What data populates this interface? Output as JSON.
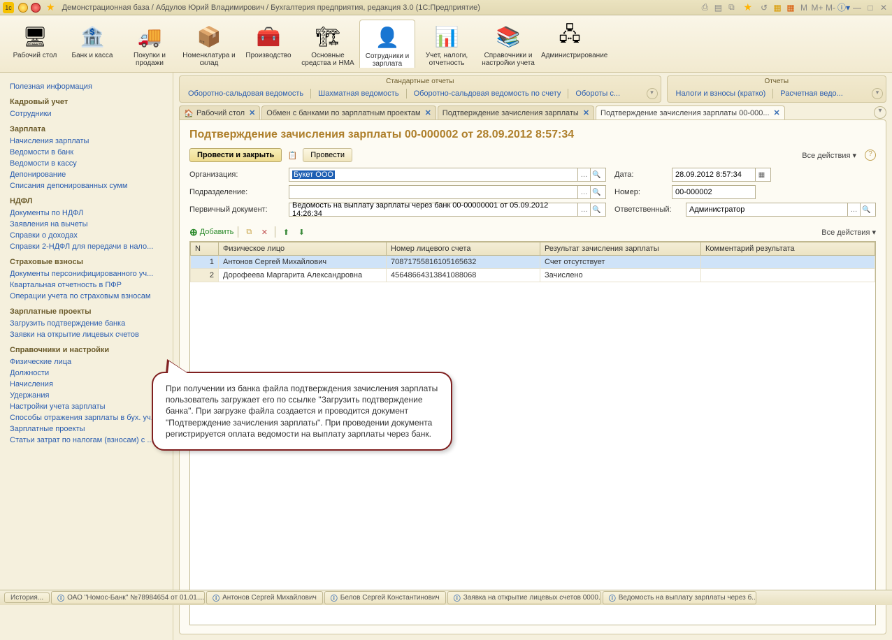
{
  "titlebar": {
    "title": "Демонстрационная база / Абдулов Юрий Владимирович / Бухгалтерия предприятия, редакция 3.0  (1С:Предприятие)",
    "m_labels": [
      "M",
      "M+",
      "M-"
    ]
  },
  "toolbar": [
    {
      "label": "Рабочий стол"
    },
    {
      "label": "Банк и касса"
    },
    {
      "label": "Покупки и продажи"
    },
    {
      "label": "Номенклатура и склад"
    },
    {
      "label": "Производство"
    },
    {
      "label": "Основные средства и НМА"
    },
    {
      "label": "Сотрудники и зарплата"
    },
    {
      "label": "Учет, налоги, отчетность"
    },
    {
      "label": "Справочники и настройки учета"
    },
    {
      "label": "Администрирование"
    }
  ],
  "sidebar": {
    "top_link": "Полезная информация",
    "groups": [
      {
        "title": "Кадровый учет",
        "items": [
          "Сотрудники"
        ]
      },
      {
        "title": "Зарплата",
        "items": [
          "Начисления зарплаты",
          "Ведомости в банк",
          "Ведомости в кассу",
          "Депонирование",
          "Списания депонированных сумм"
        ]
      },
      {
        "title": "НДФЛ",
        "items": [
          "Документы по НДФЛ",
          "Заявления на вычеты",
          "Справки о доходах",
          "Справки 2-НДФЛ для передачи в нало..."
        ]
      },
      {
        "title": "Страховые взносы",
        "items": [
          "Документы персонифицированного уч...",
          "Квартальная отчетность в ПФР",
          "Операции учета по страховым взносам"
        ]
      },
      {
        "title": "Зарплатные проекты",
        "items": [
          "Загрузить подтверждение банка",
          "Заявки на открытие лицевых счетов"
        ]
      },
      {
        "title": "Справочники и настройки",
        "items": [
          "Физические лица",
          "Должности",
          "Начисления",
          "Удержания",
          "Настройки учета зарплаты",
          "Способы отражения зарплаты в бух. уч...",
          "Зарплатные проекты",
          "Статьи затрат по налогам (взносам) с ..."
        ]
      }
    ]
  },
  "reports": {
    "left": {
      "title": "Стандартные отчеты",
      "items": [
        "Оборотно-сальдовая ведомость",
        "Шахматная ведомость",
        "Оборотно-сальдовая ведомость по счету",
        "Обороты с..."
      ]
    },
    "right": {
      "title": "Отчеты",
      "items": [
        "Налоги и взносы (кратко)",
        "Расчетная ведо..."
      ]
    }
  },
  "tabs": [
    {
      "label": "Рабочий стол",
      "closable": true
    },
    {
      "label": "Обмен с банками по зарплатным проектам",
      "closable": true
    },
    {
      "label": "Подтверждение зачисления зарплаты",
      "closable": true
    },
    {
      "label": "Подтверждение зачисления зарплаты 00-000...",
      "closable": true,
      "active": true
    }
  ],
  "document": {
    "title": "Подтверждение зачисления зарплаты 00-000002 от 28.09.2012 8:57:34",
    "btn_primary": "Провести и закрыть",
    "btn_post": "Провести",
    "all_actions": "Все действия",
    "labels": {
      "org": "Организация:",
      "dept": "Подразделение:",
      "primary_doc": "Первичный документ:",
      "date": "Дата:",
      "number": "Номер:",
      "responsible": "Ответственный:"
    },
    "values": {
      "org": "Букет ООО",
      "dept": "",
      "primary_doc": "Ведомость на выплату зарплаты через банк 00-00000001 от 05.09.2012 14:26:34",
      "date": "28.09.2012  8:57:34",
      "number": "00-000002",
      "responsible": "Администратор"
    },
    "add_label": "Добавить",
    "grid": {
      "headers": [
        "N",
        "Физическое лицо",
        "Номер лицевого счета",
        "Результат зачисления зарплаты",
        "Комментарий результата"
      ],
      "rows": [
        {
          "n": "1",
          "person": "Антонов Сергей Михайлович",
          "acct": "70871755816105165632",
          "result": "Счет отсутствует",
          "comment": ""
        },
        {
          "n": "2",
          "person": "Дорофеева Маргарита Александровна",
          "acct": "45648664313841088068",
          "result": "Зачислено",
          "comment": ""
        }
      ]
    }
  },
  "callout": "При получении из банка файла подтверждения зачисления зарплаты пользователь загружает его по ссылке  \"Загрузить подтверждение банка\". При загрузке файла создается и проводится документ \"Подтверждение зачисления зарплаты\". При проведении документа регистрируется оплата ведомости на выплату зарплаты через банк.",
  "statusbar": {
    "history": "История...",
    "items": [
      "ОАО \"Номос-Банк\" №78984654 от 01.01....",
      "Антонов Сергей Михайлович",
      "Белов Сергей Константинович",
      "Заявка на открытие лицевых счетов 0000...",
      "Ведомость на выплату зарплаты через б..."
    ]
  }
}
